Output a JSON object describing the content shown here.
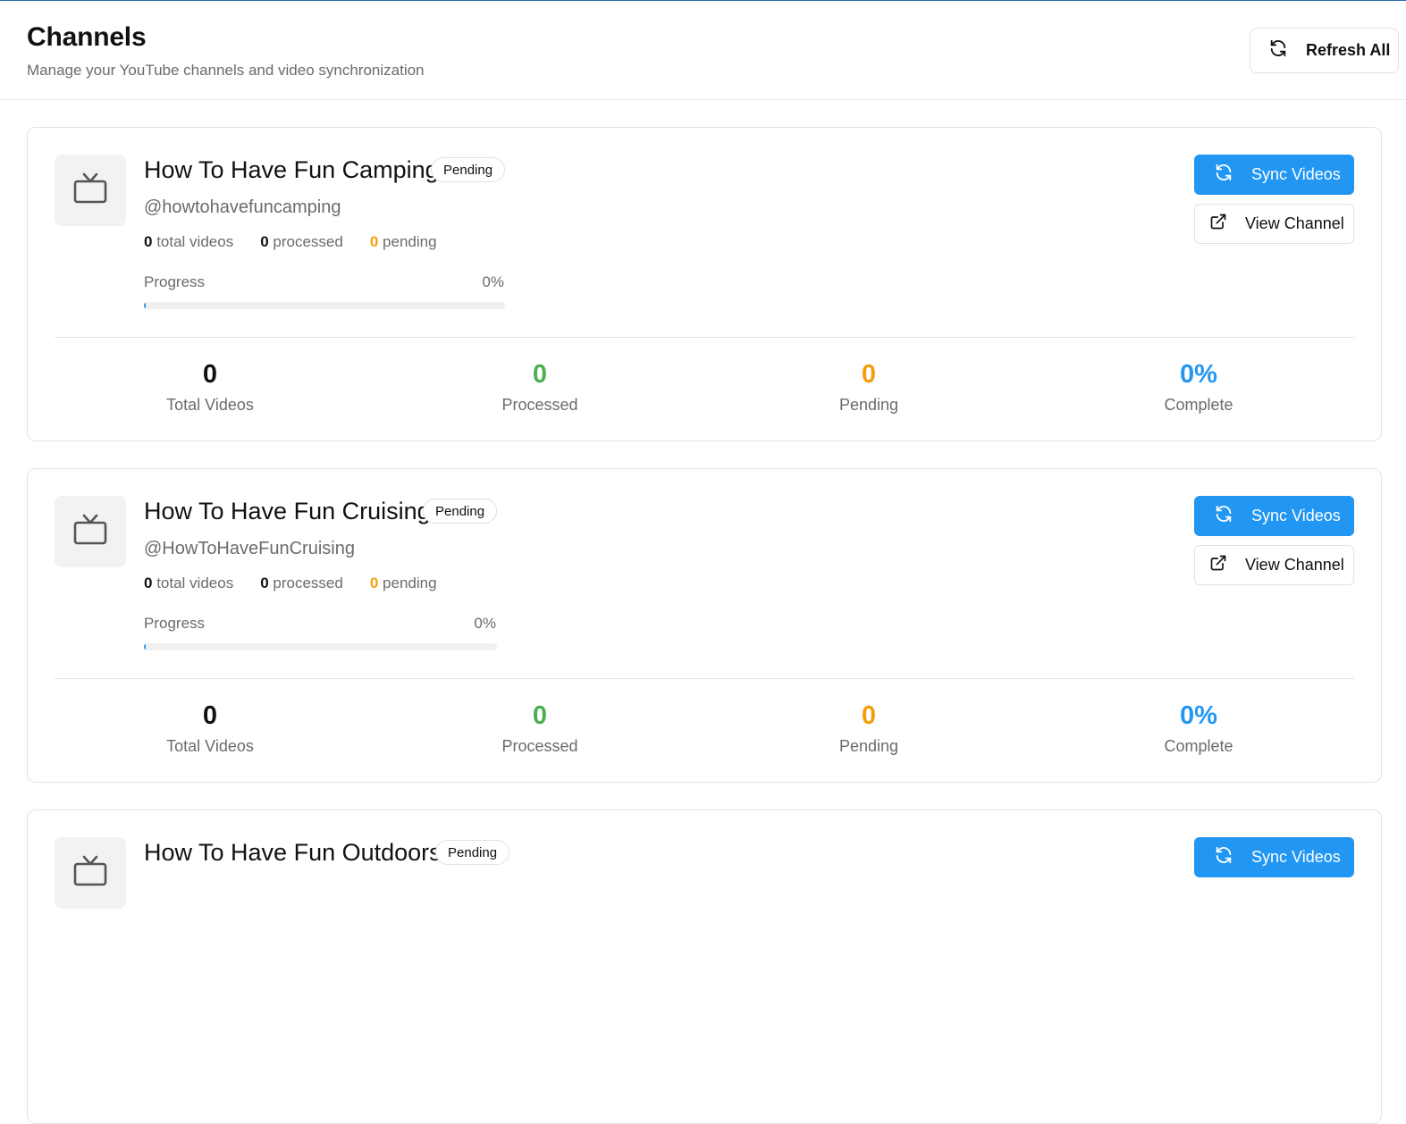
{
  "header": {
    "title": "Channels",
    "subtitle": "Manage your YouTube channels and video synchronization",
    "refresh_label": "Refresh All"
  },
  "colors": {
    "primary": "#2196f3",
    "processed": "#4caf50",
    "pending": "#f59e0b",
    "muted_text": "#6b6b6b"
  },
  "channels": [
    {
      "name": "How To Have Fun Camping",
      "status": "Pending",
      "handle": "@howtohavefuncamping",
      "total_videos": "0",
      "total_videos_label": "total videos",
      "processed": "0",
      "processed_label": "processed",
      "pending": "0",
      "pending_label": "pending",
      "progress_label": "Progress",
      "progress_pct": "0%",
      "progress_value": 0,
      "sync_label": "Sync Videos",
      "view_label": "View Channel",
      "stats": {
        "total_value": "0",
        "total_label": "Total Videos",
        "processed_value": "0",
        "processed_label": "Processed",
        "pending_value": "0",
        "pending_label": "Pending",
        "complete_value": "0%",
        "complete_label": "Complete"
      }
    },
    {
      "name": "How To Have Fun Cruising",
      "status": "Pending",
      "handle": "@HowToHaveFunCruising",
      "total_videos": "0",
      "total_videos_label": "total videos",
      "processed": "0",
      "processed_label": "processed",
      "pending": "0",
      "pending_label": "pending",
      "progress_label": "Progress",
      "progress_pct": "0%",
      "progress_value": 0,
      "sync_label": "Sync Videos",
      "view_label": "View Channel",
      "stats": {
        "total_value": "0",
        "total_label": "Total Videos",
        "processed_value": "0",
        "processed_label": "Processed",
        "pending_value": "0",
        "pending_label": "Pending",
        "complete_value": "0%",
        "complete_label": "Complete"
      }
    },
    {
      "name": "How To Have Fun Outdoors",
      "status": "Pending",
      "sync_label": "Sync Videos"
    }
  ]
}
